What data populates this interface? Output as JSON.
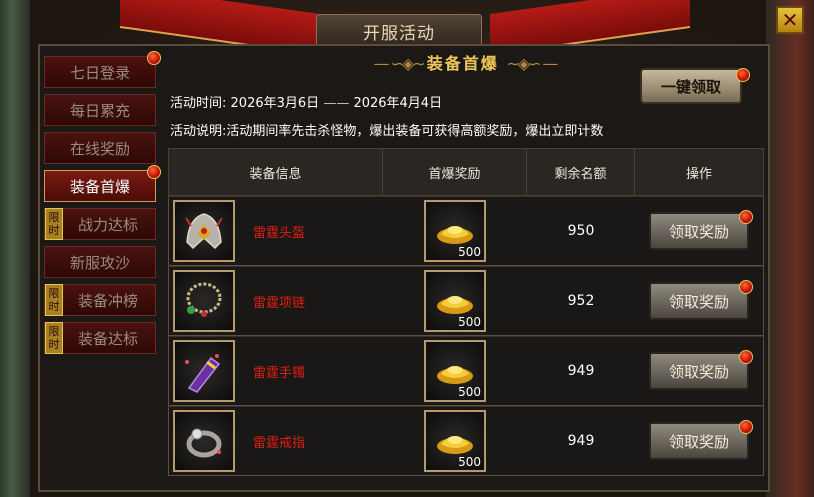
{
  "window": {
    "title": "开服活动",
    "close_label": "✕"
  },
  "tabs": [
    {
      "label": "七日登录",
      "limited": false,
      "active": false,
      "badge": true
    },
    {
      "label": "每日累充",
      "limited": false,
      "active": false,
      "badge": false
    },
    {
      "label": "在线奖励",
      "limited": false,
      "active": false,
      "badge": false
    },
    {
      "label": "装备首爆",
      "limited": false,
      "active": true,
      "badge": true
    },
    {
      "label": "战力达标",
      "limited": true,
      "active": false,
      "badge": false
    },
    {
      "label": "新服攻沙",
      "limited": false,
      "active": false,
      "badge": false
    },
    {
      "label": "装备冲榜",
      "limited": true,
      "active": false,
      "badge": false
    },
    {
      "label": "装备达标",
      "limited": true,
      "active": false,
      "badge": false
    }
  ],
  "limit_badge": {
    "char1": "限",
    "char2": "时"
  },
  "content": {
    "heading": "装备首爆",
    "time_label": "活动时间:",
    "time_start": "2026年3月6日",
    "time_sep": "——",
    "time_end": "2026年4月4日",
    "desc_label": "活动说明:",
    "desc_text": "活动期间率先击杀怪物，爆出装备可获得高额奖励，爆出立即计数",
    "claim_all": "一键领取"
  },
  "table": {
    "headers": [
      "装备信息",
      "首爆奖励",
      "剩余名额",
      "操作"
    ],
    "rows": [
      {
        "icon": "helmet-icon",
        "name": "雷霆头盔",
        "reward_icon": "gold-ingot-icon",
        "reward_count": "500",
        "remaining": "950",
        "action": "领取奖励"
      },
      {
        "icon": "necklace-icon",
        "name": "雷霆项链",
        "reward_icon": "gold-ingot-icon",
        "reward_count": "500",
        "remaining": "952",
        "action": "领取奖励"
      },
      {
        "icon": "bracer-icon",
        "name": "雷霆手镯",
        "reward_icon": "gold-ingot-icon",
        "reward_count": "500",
        "remaining": "949",
        "action": "领取奖励"
      },
      {
        "icon": "ring-icon",
        "name": "雷霆戒指",
        "reward_icon": "gold-ingot-icon",
        "reward_count": "500",
        "remaining": "949",
        "action": "领取奖励"
      }
    ]
  }
}
